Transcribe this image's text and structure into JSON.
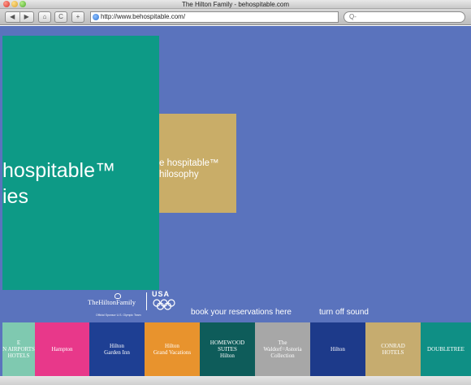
{
  "window": {
    "title": "The Hilton Family - behospitable.com"
  },
  "toolbar": {
    "back": "◀",
    "forward": "▶",
    "home": "⌂",
    "reload": "C",
    "add": "+",
    "url": "http://www.behospitable.com/",
    "search_placeholder": "Q-"
  },
  "hero": {
    "hospitable_text": "hospitable™\nies",
    "philosophy_text": "e hospitable™\nhilosophy"
  },
  "colors": {
    "page_bg": "#5a73bd",
    "teal": "#0d9a86",
    "tan": "#c9ad68"
  },
  "logo": {
    "wordmark": "TheHiltonFamily",
    "usa": "USA",
    "sponsor": "Official Sponsor U.S. Olympic Team"
  },
  "links": {
    "book": "book your reservations here",
    "sound": "turn off sound"
  },
  "brands": [
    {
      "label": "E\nN AIRPORTS\nHOTELS",
      "color": "#7fc9b0"
    },
    {
      "label": "Hampton",
      "color": "#e8388a"
    },
    {
      "label": "Hilton\nGarden Inn",
      "color": "#1e3f93"
    },
    {
      "label": "Hilton\nGrand Vacations",
      "color": "#e8932d"
    },
    {
      "label": "HOMEWOOD\nSUITES\nHilton",
      "color": "#0e5c5a"
    },
    {
      "label": "The\nWaldorf=Astoria\nCollection",
      "color": "#a7a7a7"
    },
    {
      "label": "Hilton",
      "color": "#1d3a8a"
    },
    {
      "label": "CONRAD\nHOTELS",
      "color": "#c6ac6f"
    },
    {
      "label": "DOUBLETREE",
      "color": "#0f8f85"
    }
  ]
}
